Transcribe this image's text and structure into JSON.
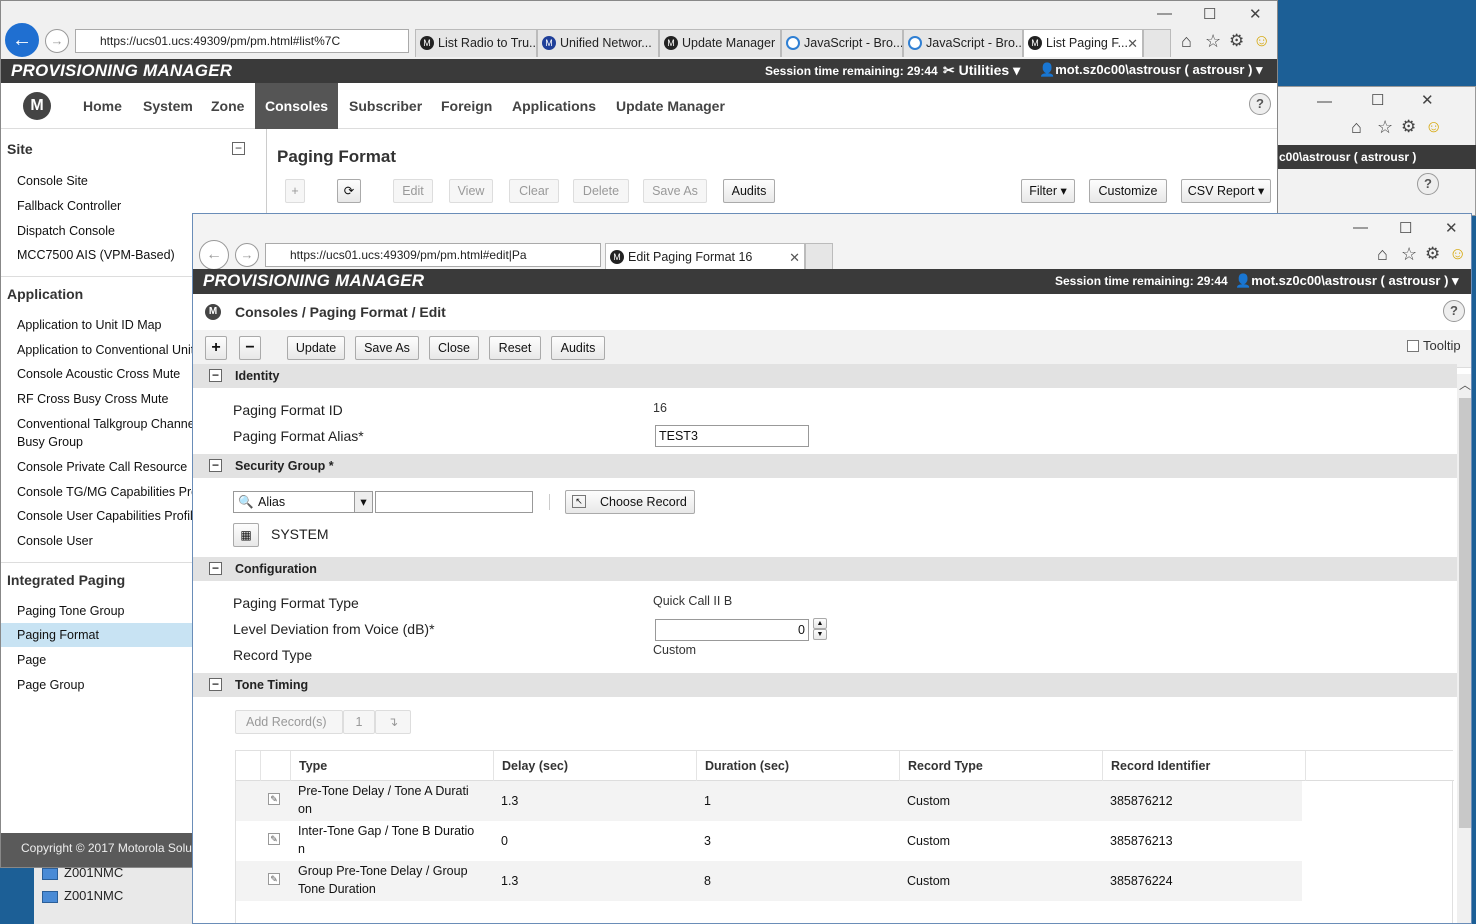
{
  "desktop": {
    "items": [
      "Z001NMC",
      "Z001NMC"
    ]
  },
  "back_window": {
    "address": "https://ucs01.ucs:49309/pm/pm.html#list%7C",
    "tabs": [
      {
        "label": "List Radio to Tru...",
        "icon": "motorola"
      },
      {
        "label": "Unified Networ...",
        "icon": "motorola-blue"
      },
      {
        "label": "Update Manager",
        "icon": "motorola"
      },
      {
        "label": "JavaScript - Bro...",
        "icon": "ie"
      },
      {
        "label": "JavaScript - Bro...",
        "icon": "ie"
      },
      {
        "label": "List Paging F...",
        "icon": "motorola"
      }
    ],
    "app_title": "PROVISIONING MANAGER",
    "session": "Session time remaining: 29:44",
    "utilities": "Utilities",
    "user": "mot.sz0c00\\astrousr ( astrousr )",
    "menu": [
      "Home",
      "System",
      "Zone",
      "Consoles",
      "Subscriber",
      "Foreign",
      "Applications",
      "Update Manager"
    ],
    "active_menu": "Consoles",
    "sidebar": {
      "site_head": "Site",
      "site_items": [
        "Console Site",
        "Fallback Controller",
        "Dispatch Console",
        "MCC7500 AIS (VPM-Based)"
      ],
      "app_head": "Application",
      "app_items": [
        "Application to Unit ID Map",
        "Application to Conventional Unit M",
        "Console Acoustic Cross Mute",
        "RF Cross Busy Cross Mute",
        "Conventional Talkgroup Channel",
        "Busy Group",
        "Console Private Call Resource",
        "Console TG/MG Capabilities Prof",
        "Console User Capabilities Profile",
        "Console User"
      ],
      "ip_head": "Integrated Paging",
      "ip_items": [
        "Paging Tone Group",
        "Paging Format",
        "Page",
        "Page Group"
      ],
      "selected": "Paging Format"
    },
    "footer": "Copyright © 2017 Motorola Solu",
    "page_title": "Paging Format",
    "toolbar": [
      "Edit",
      "View",
      "Clear",
      "Delete",
      "Save As",
      "Audits"
    ],
    "toolbar_right": [
      "Filter",
      "Customize",
      "CSV Report"
    ],
    "third_user": "c00\\astrousr ( astrousr )"
  },
  "front_window": {
    "address": "https://ucs01.ucs:49309/pm/pm.html#edit|Pa",
    "tab": "Edit Paging Format 16",
    "app_title": "PROVISIONING MANAGER",
    "session": "Session time remaining: 29:44",
    "user": "mot.sz0c00\\astrousr ( astrousr )",
    "breadcrumb": "Consoles / Paging Format / Edit",
    "toolbar": {
      "plus": "+",
      "minus": "−",
      "update": "Update",
      "save_as": "Save As",
      "close": "Close",
      "reset": "Reset",
      "audits": "Audits",
      "tooltip": "Tooltip"
    },
    "identity": {
      "head": "Identity",
      "id_label": "Paging Format ID",
      "id_value": "16",
      "alias_label": "Paging Format Alias*",
      "alias_value": "TEST3"
    },
    "security": {
      "head": "Security Group *",
      "search_field": "Alias",
      "choose": "Choose Record",
      "value": "SYSTEM"
    },
    "configuration": {
      "head": "Configuration",
      "type_label": "Paging Format Type",
      "type_value": "Quick Call II B",
      "level_label": "Level Deviation from Voice (dB)*",
      "level_value": "0",
      "record_label": "Record Type",
      "record_value": "Custom"
    },
    "tone_timing": {
      "head": "Tone Timing",
      "add_records": "Add Record(s)",
      "add_count": "1",
      "columns": [
        "Type",
        "Delay (sec)",
        "Duration (sec)",
        "Record Type",
        "Record Identifier"
      ],
      "rows": [
        {
          "type1": "Pre-Tone Delay / Tone A Durati",
          "type2": "on",
          "delay": "1.3",
          "duration": "1",
          "record_type": "Custom",
          "record_id": "385876212"
        },
        {
          "type1": "Inter-Tone Gap / Tone B Duratio",
          "type2": "n",
          "delay": "0",
          "duration": "3",
          "record_type": "Custom",
          "record_id": "385876213"
        },
        {
          "type1": "Group Pre-Tone Delay / Group",
          "type2": "Tone Duration",
          "delay": "1.3",
          "duration": "8",
          "record_type": "Custom",
          "record_id": "385876224"
        }
      ]
    }
  }
}
